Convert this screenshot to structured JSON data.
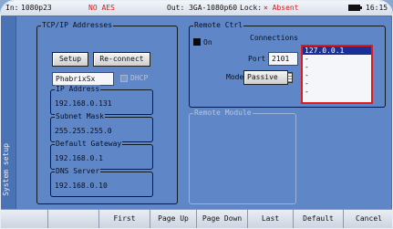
{
  "status_bar": {
    "input_label": "In:",
    "input_format": "1080p23",
    "input_alert": "NO AES",
    "output": "Out: 3GA-1080p60",
    "lock_label": "Lock:",
    "lock_value": "× Absent",
    "clock": "16:15"
  },
  "side_tab": {
    "label": "System setup"
  },
  "tcpip": {
    "title": "TCP/IP Addresses",
    "setup_button": "Setup",
    "reconnect_button": "Re-connect",
    "hostname": "PhabrixSx",
    "dhcp_label": "DHCP",
    "dhcp_checked": false,
    "ip_address": {
      "title": "IP Address",
      "value": "192.168.0.131"
    },
    "subnet_mask": {
      "title": "Subnet Mask",
      "value": "255.255.255.0"
    },
    "default_gateway": {
      "title": "Default Gateway",
      "value": "192.168.0.1"
    },
    "dns_server": {
      "title": "DNS Server",
      "value": "192.168.0.10"
    }
  },
  "remote_ctrl": {
    "title": "Remote Ctrl",
    "on_label": "On",
    "on_checked": true,
    "port_label": "Port",
    "port_value": "2101",
    "mode_label": "Mode",
    "mode_value": "Passive",
    "connections_label": "Connections",
    "connections": [
      "127.0.0.1",
      "-",
      "-",
      "-",
      "-",
      "-"
    ],
    "selected_connection": 0
  },
  "remote_module": {
    "title": "Remote Module"
  },
  "softkeys": [
    "",
    "",
    "First",
    "Page Up",
    "Page Down",
    "Last",
    "Default",
    "Cancel"
  ],
  "colors": {
    "alert": "#e01818",
    "selection": "#1a2f96",
    "panel": "#5f86c6"
  }
}
